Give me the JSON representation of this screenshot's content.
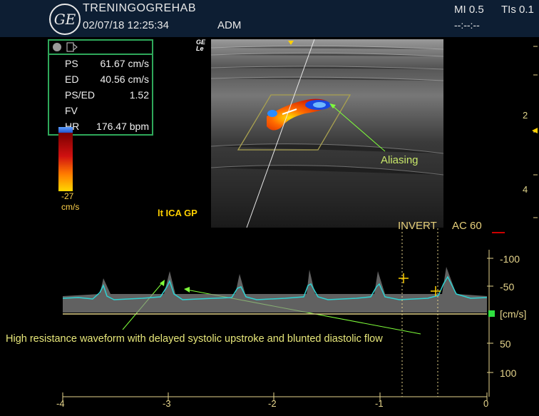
{
  "header": {
    "site": "TRENINGOGREHAB",
    "datetime": "02/07/18 12:25:34",
    "operator": "ADM",
    "mi": "MI 0.5",
    "tis": "TIs 0.1",
    "dashes": "--:--:--",
    "logo_text": "GE"
  },
  "measurements": [
    {
      "label": "PS",
      "value": "61.67 cm/s"
    },
    {
      "label": "ED",
      "value": "40.56 cm/s"
    },
    {
      "label": "PS/ED",
      "value": "1.52"
    },
    {
      "label": "FV",
      "value": ""
    },
    {
      "label": "HR",
      "value": "176.47 bpm"
    }
  ],
  "color_scale": {
    "min": "-27",
    "unit": "cm/s"
  },
  "probe_label": "GE\nLе",
  "vessel_label": "lt ICA GP",
  "depth_labels": [
    "2",
    "4"
  ],
  "annotations": {
    "aliasing": "Aliasing",
    "caption": "High resistance waveform with delayed systolic upstroke and blunted diastolic flow",
    "invert": "INVERT",
    "ac": "AC 60"
  },
  "velocity_scale": {
    "ticks": [
      "-100",
      "-50",
      "50",
      "100"
    ],
    "unit": "[cm/s]"
  },
  "time_axis": {
    "ticks": [
      "-4",
      "-3",
      "-2",
      "-1",
      "0"
    ]
  },
  "colors": {
    "header_bg": "#0d1e33",
    "measure_border": "#2fa85a",
    "waveform_trace": "#2fd3d3",
    "label_yellow": "#ffd000",
    "annotation_green": "#c9e86a"
  }
}
